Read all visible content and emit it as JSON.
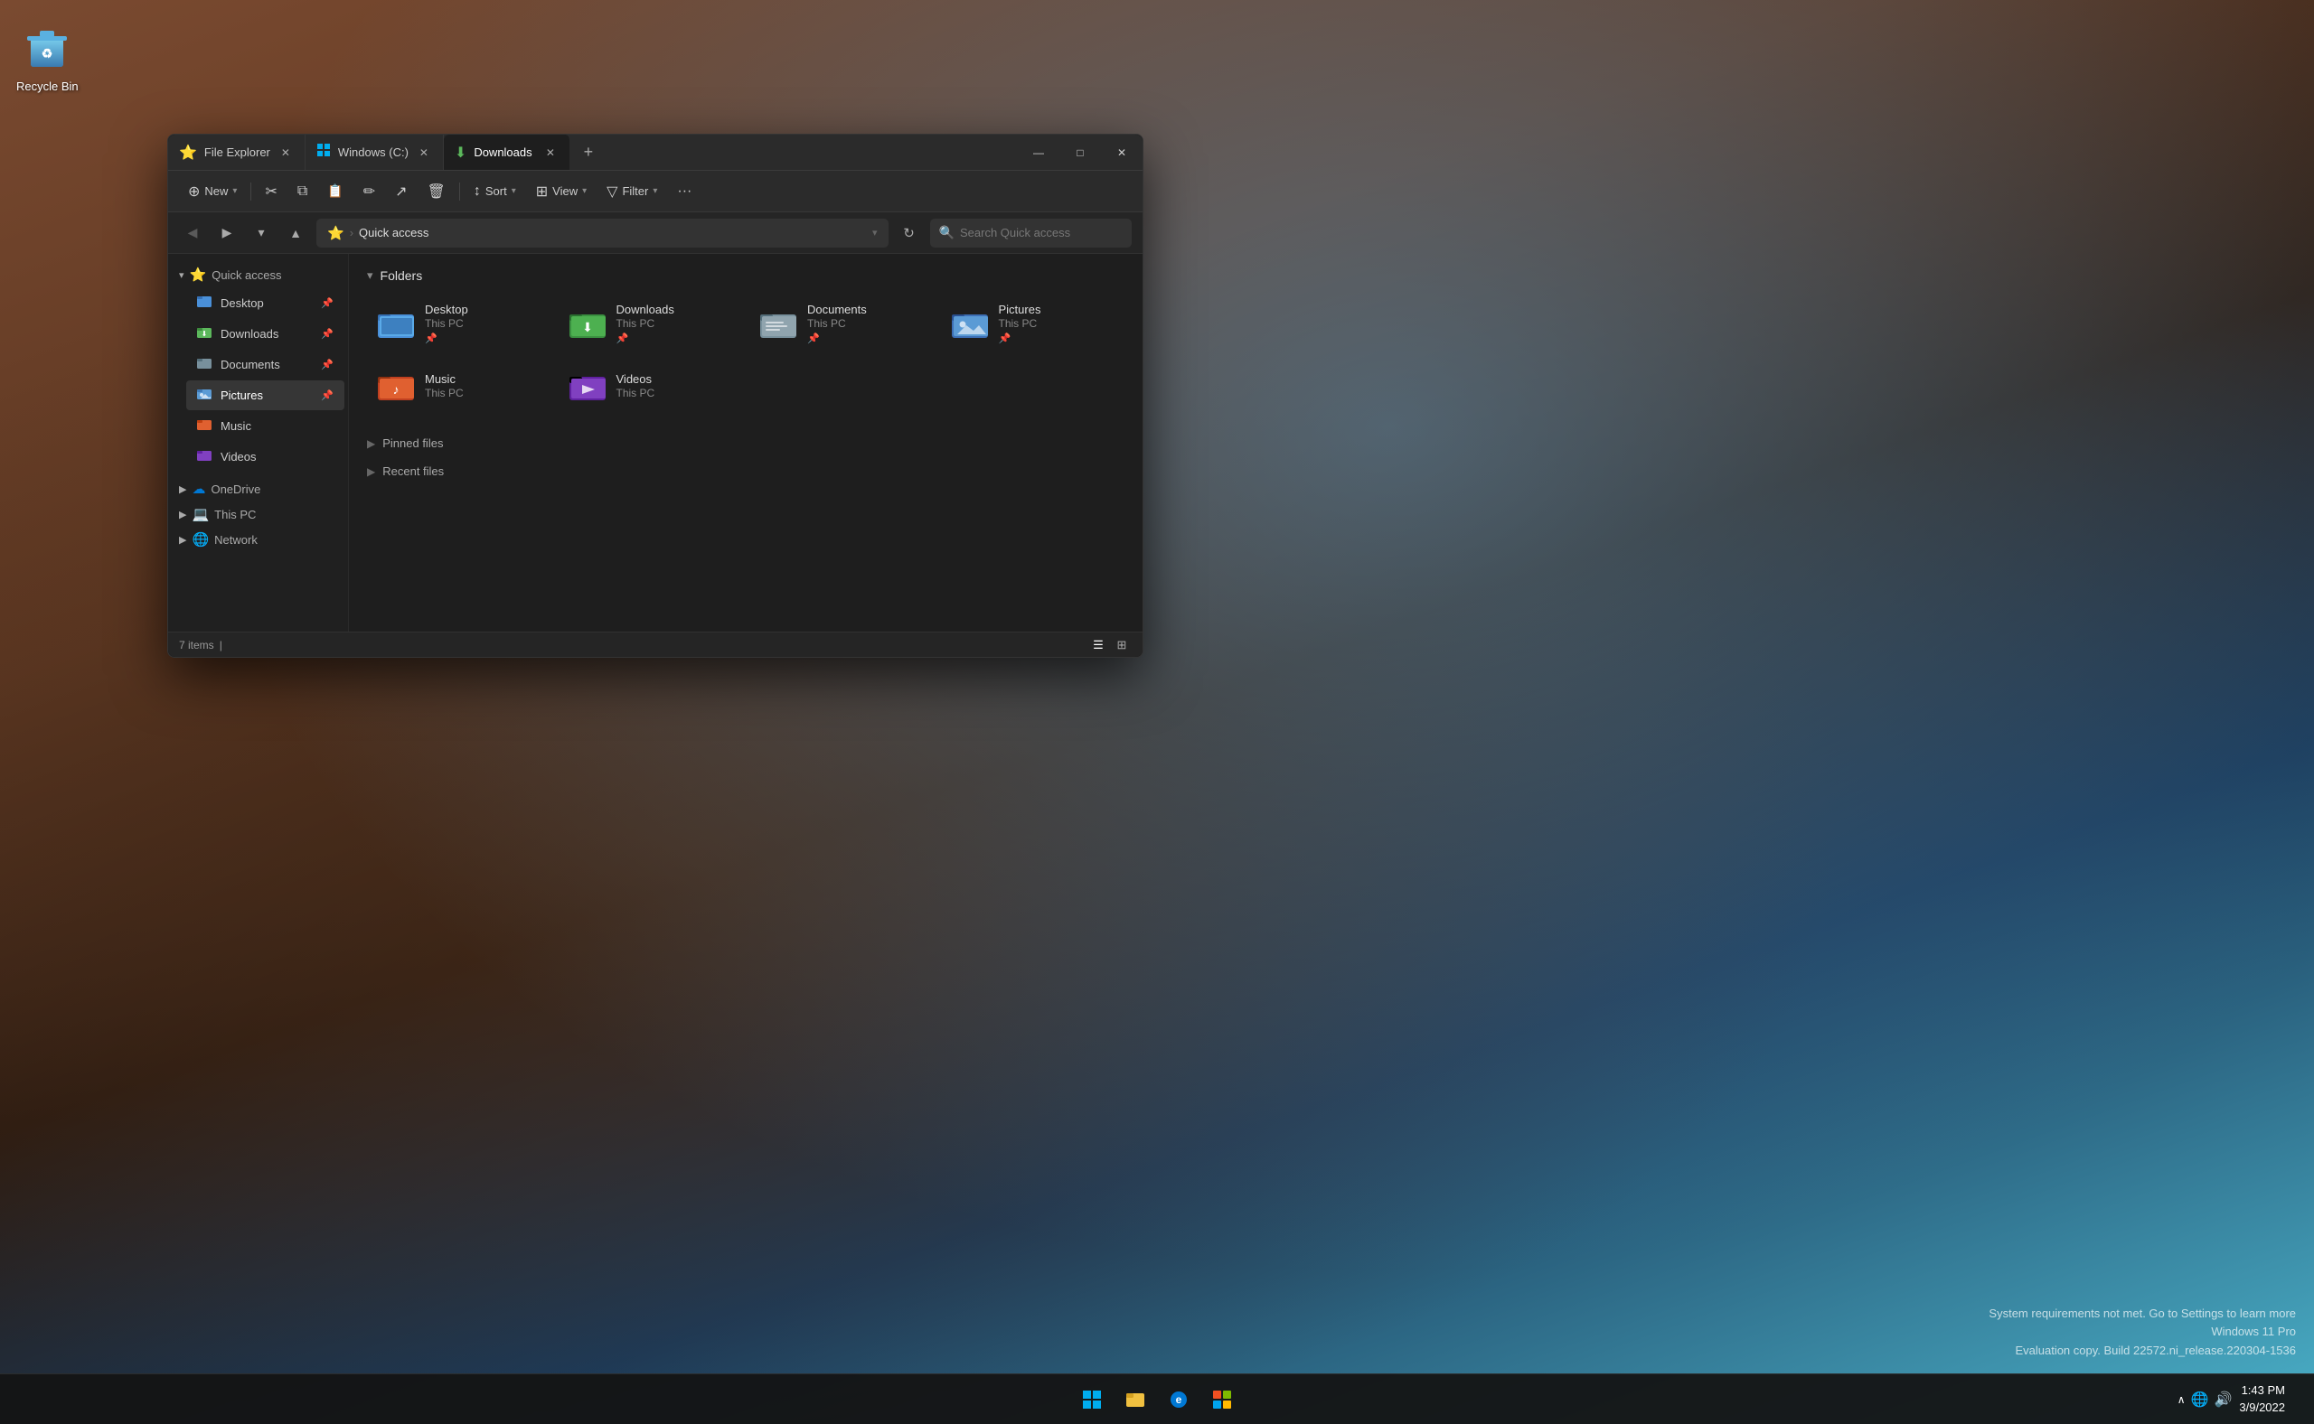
{
  "desktop": {
    "recycle_bin_label": "Recycle Bin"
  },
  "taskbar": {
    "time": "1:43 PM",
    "date": "3/9/2022",
    "icons": [
      "⊞",
      "🗂",
      "e",
      "🛍"
    ]
  },
  "watermark": {
    "line1": "System requirements not met. Go to Settings to learn more",
    "line2": "Windows 11 Pro",
    "line3": "Evaluation copy. Build 22572.ni_release.220304-1536"
  },
  "explorer": {
    "tabs": [
      {
        "id": "file-explorer",
        "icon": "⭐",
        "label": "File Explorer",
        "active": false
      },
      {
        "id": "windows-c",
        "icon": "💾",
        "label": "Windows (C:)",
        "active": false
      },
      {
        "id": "downloads",
        "icon": "⬇",
        "label": "Downloads",
        "active": true
      }
    ],
    "tab_add_label": "+",
    "window_controls": {
      "minimize": "—",
      "maximize": "□",
      "close": "✕"
    },
    "toolbar": {
      "new_label": "New",
      "new_icon": "⊕",
      "cut_icon": "✂",
      "copy_icon": "⧉",
      "paste_icon": "📋",
      "rename_icon": "✏",
      "share_icon": "↗",
      "delete_icon": "🗑",
      "sort_label": "Sort",
      "sort_icon": "≡",
      "view_label": "View",
      "view_icon": "⊞",
      "filter_label": "Filter",
      "filter_icon": "▽",
      "more_icon": "•••"
    },
    "address": {
      "star_icon": "⭐",
      "separator": "›",
      "path": "Quick access",
      "search_placeholder": "Search Quick access"
    },
    "sidebar": {
      "quick_access_label": "Quick access",
      "quick_access_icon": "⭐",
      "items": [
        {
          "id": "desktop",
          "icon": "🖥",
          "label": "Desktop",
          "pinned": true
        },
        {
          "id": "downloads",
          "icon": "⬇",
          "label": "Downloads",
          "pinned": true
        },
        {
          "id": "documents",
          "icon": "📄",
          "label": "Documents",
          "pinned": true
        },
        {
          "id": "pictures",
          "icon": "🖼",
          "label": "Pictures",
          "pinned": true
        },
        {
          "id": "music",
          "icon": "🎵",
          "label": "Music",
          "pinned": false
        },
        {
          "id": "videos",
          "icon": "🎬",
          "label": "Videos",
          "pinned": false
        }
      ],
      "onedrive_label": "OneDrive",
      "onedrive_icon": "☁",
      "thispc_label": "This PC",
      "thispc_icon": "💻",
      "network_label": "Network",
      "network_icon": "🌐"
    },
    "content": {
      "folders_section": "Folders",
      "pinned_files_section": "Pinned files",
      "recent_files_section": "Recent files",
      "folders": [
        {
          "id": "desktop",
          "name": "Desktop",
          "sub": "This PC",
          "color": "blue",
          "pinned": true
        },
        {
          "id": "downloads",
          "name": "Downloads",
          "sub": "This PC",
          "color": "green",
          "pinned": true
        },
        {
          "id": "documents",
          "name": "Documents",
          "sub": "This PC",
          "color": "gray",
          "pinned": true
        },
        {
          "id": "pictures",
          "name": "Pictures",
          "sub": "This PC",
          "color": "blue2",
          "pinned": true
        },
        {
          "id": "music",
          "name": "Music",
          "sub": "This PC",
          "color": "orange",
          "pinned": false
        },
        {
          "id": "videos",
          "name": "Videos",
          "sub": "This PC",
          "color": "purple",
          "pinned": false
        }
      ]
    },
    "status": {
      "items_count": "7 items",
      "separator": "|"
    }
  }
}
